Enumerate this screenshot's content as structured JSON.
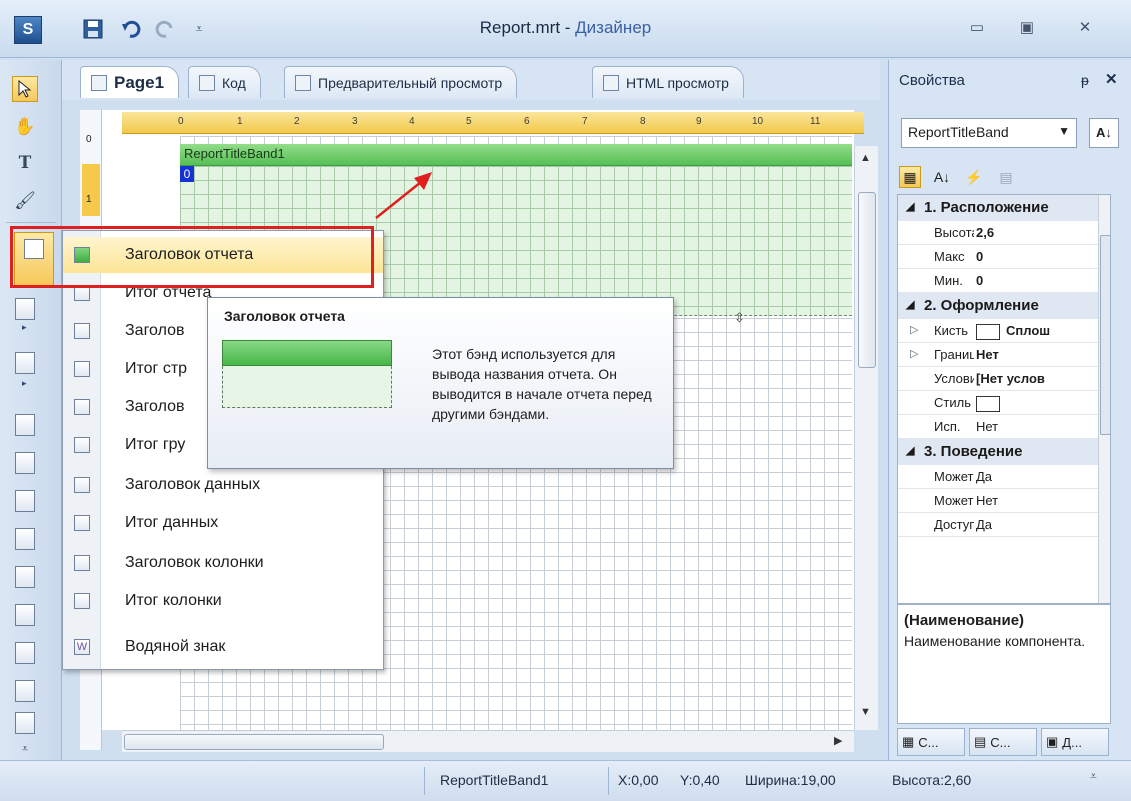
{
  "window": {
    "title_main": "Report.mrt",
    "title_sep": " - ",
    "title_sub": "Дизайнер",
    "app_icon": "app-icon",
    "min_label": "▭",
    "max_label": "▣",
    "close_label": "✕"
  },
  "tabs": [
    {
      "label": "Page1",
      "icon": "page-icon"
    },
    {
      "label": "Код",
      "icon": "code-icon"
    },
    {
      "label": "Предварительный просмотр",
      "icon": "preview-icon"
    },
    {
      "label": "HTML просмотр",
      "icon": "html-preview-icon"
    }
  ],
  "ruler": {
    "ticks": [
      "0",
      "1",
      "2",
      "3",
      "4",
      "5",
      "6",
      "7",
      "8",
      "9",
      "10",
      "11"
    ]
  },
  "vruler": {
    "ticks": [
      "0",
      "1"
    ]
  },
  "band": {
    "name": "ReportTitleBand1",
    "badge": "0"
  },
  "menu": {
    "items": [
      "Заголовок отчета",
      "Итог отчета",
      "Заголовок страницы",
      "Итог страницы",
      "Заголовок группы",
      "Итог группы",
      "Заголовок данных",
      "Итог данных",
      "Заголовок колонки",
      "Итог колонки",
      "Водяной знак"
    ],
    "visible": [
      "Заголовок отчета",
      "Итог отчета",
      "Заголов",
      "Итог стр",
      "Заголов",
      "Итог гру",
      "Заголовок данных",
      "Итог данных",
      "Заголовок колонки",
      "Итог колонки",
      "Водяной знак"
    ]
  },
  "tooltip": {
    "title": "Заголовок отчета",
    "text": "Этот бэнд используется для вывода названия отчета. Он выводится в начале отчета перед другими бэндами."
  },
  "properties": {
    "title": "Свойства",
    "pin": "ᵽ",
    "close": "✕",
    "component": "ReportTitleBand",
    "categories": [
      {
        "label": "1. Расположение"
      },
      {
        "label": "2. Оформление"
      },
      {
        "label": "3. Поведение"
      }
    ],
    "rows": [
      {
        "name": "Высота",
        "value": "2,6"
      },
      {
        "name": "Макс",
        "value": "0"
      },
      {
        "name": "Мин.",
        "value": "0"
      },
      {
        "name": "Кисть",
        "value": "Сплош"
      },
      {
        "name": "Граница",
        "value": "Нет"
      },
      {
        "name": "Условия",
        "value": "[Нет услов"
      },
      {
        "name": "Стиль",
        "value": ""
      },
      {
        "name": "Исп.",
        "value": "Нет"
      },
      {
        "name": "Может",
        "value": "Да"
      },
      {
        "name": "Может",
        "value": "Нет"
      },
      {
        "name": "Доступ",
        "value": "Да"
      }
    ],
    "desc_title": "(Наименование)",
    "desc_text": "Наименование компонента.",
    "bottom_tabs": [
      "С...",
      "С...",
      "Д..."
    ]
  },
  "status": {
    "component": "ReportTitleBand1",
    "x": "X:0,00",
    "y": "Y:0,40",
    "width": "Ширина:19,00",
    "height": "Высота:2,60"
  },
  "colors": {
    "band_green": "#56bf55",
    "highlight_red": "#e02020",
    "selection_yellow": "#fde596"
  }
}
